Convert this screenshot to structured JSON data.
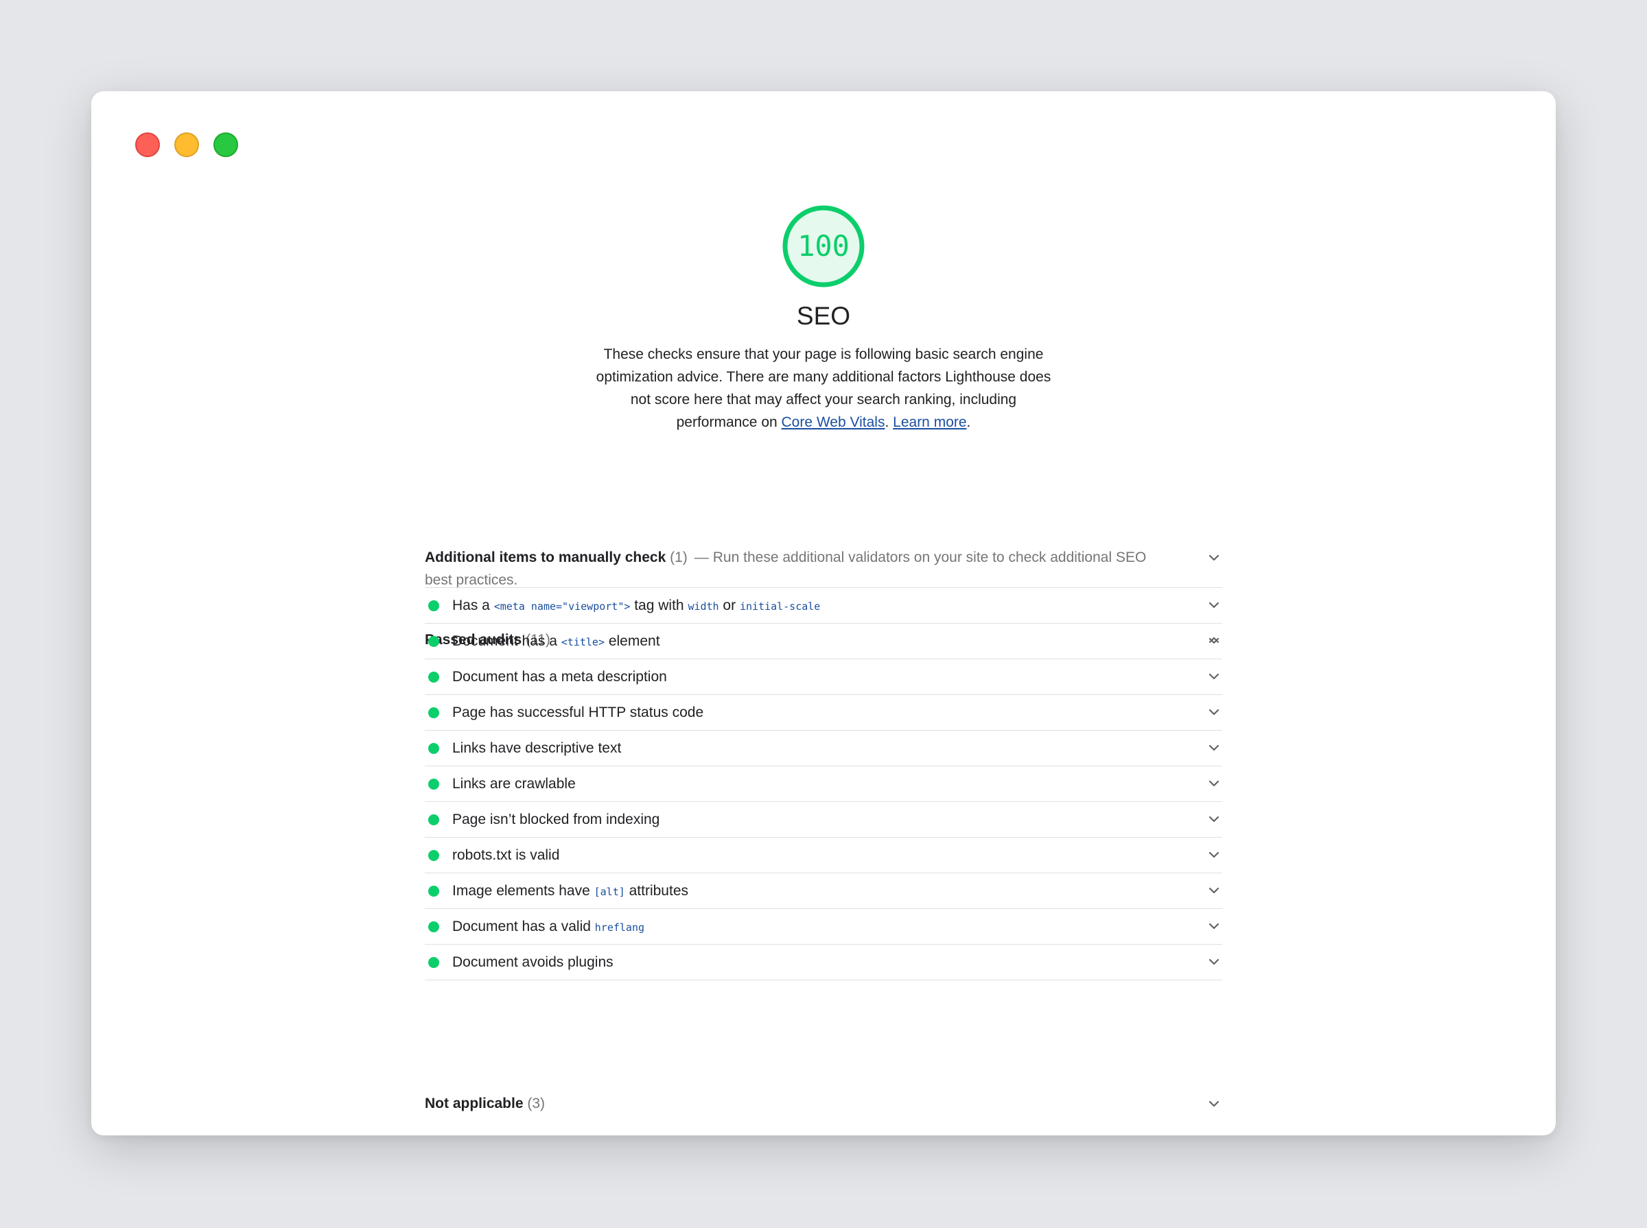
{
  "window": {
    "controls": [
      "close",
      "minimize",
      "maximize"
    ]
  },
  "gauge": {
    "score": "100",
    "fraction": 1.0,
    "color": "#0cce6b"
  },
  "category": {
    "title": "SEO",
    "description_parts": {
      "text": "These checks ensure that your page is following basic search engine optimization advice. There are many additional factors Lighthouse does not score here that may affect your search ranking, including performance on ",
      "link1": "Core Web Vitals",
      "sep": ". ",
      "link2": "Learn more",
      "end": "."
    }
  },
  "manual_group": {
    "title": "Additional items to manually check",
    "count": "(1)",
    "dash": "—",
    "description": "Run these additional validators on your site to check additional SEO best practices."
  },
  "passed_group": {
    "title": "Passed audits",
    "count": "(11)",
    "audits": [
      {
        "parts": [
          "Has a ",
          "<meta name=\"viewport\">",
          " tag with ",
          "width",
          " or ",
          "initial-scale",
          ""
        ]
      },
      {
        "parts": [
          "Document has a ",
          "<title>",
          " element"
        ]
      },
      {
        "parts": [
          "Document has a meta description"
        ]
      },
      {
        "parts": [
          "Page has successful HTTP status code"
        ]
      },
      {
        "parts": [
          "Links have descriptive text"
        ]
      },
      {
        "parts": [
          "Links are crawlable"
        ]
      },
      {
        "parts": [
          "Page isn’t blocked from indexing"
        ]
      },
      {
        "parts": [
          "robots.txt is valid"
        ]
      },
      {
        "parts": [
          "Image elements have ",
          "[alt]",
          " attributes"
        ]
      },
      {
        "parts": [
          "Document has a valid ",
          "hreflang",
          ""
        ]
      },
      {
        "parts": [
          "Document avoids plugins"
        ]
      }
    ]
  },
  "not_applicable_group": {
    "title": "Not applicable",
    "count": "(3)"
  }
}
